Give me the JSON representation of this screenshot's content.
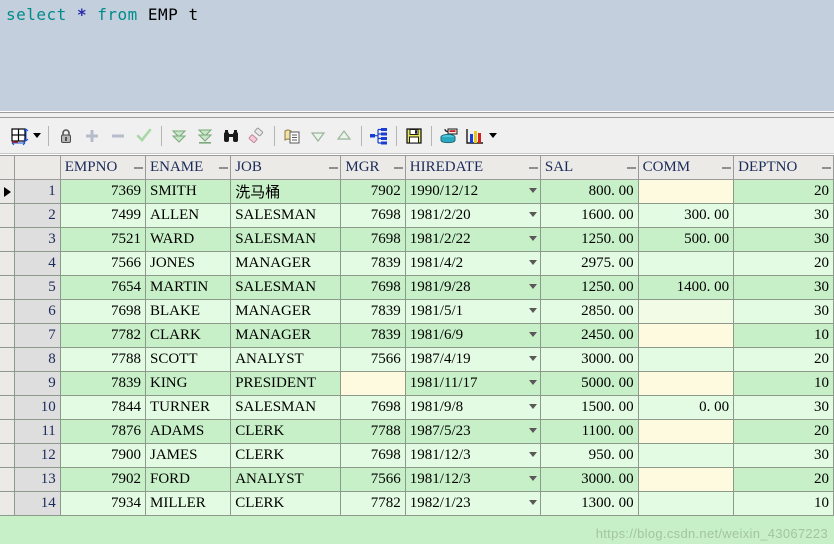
{
  "editor": {
    "sql_keyword_1": "select",
    "sql_star": "*",
    "sql_keyword_2": "from",
    "sql_table": "EMP",
    "sql_alias": "t",
    "full_sql": "select * from EMP t"
  },
  "toolbar": {
    "buttons": [
      {
        "name": "grid-layout-icon",
        "title": "Grid layout",
        "dropdown": true
      },
      {
        "name": "lock-icon",
        "title": "Lock record",
        "dropdown": false
      },
      {
        "name": "plus-icon",
        "title": "Insert record",
        "dropdown": false
      },
      {
        "name": "minus-icon",
        "title": "Delete record",
        "dropdown": false
      },
      {
        "name": "check-icon",
        "title": "Post changes",
        "dropdown": false
      },
      {
        "name": "export-down-icon",
        "title": "Fetch next page",
        "dropdown": false
      },
      {
        "name": "export-last-icon",
        "title": "Fetch last page",
        "dropdown": false
      },
      {
        "name": "binoculars-icon",
        "title": "Find",
        "dropdown": false
      },
      {
        "name": "eraser-icon",
        "title": "Clear filter",
        "dropdown": false
      },
      {
        "name": "copy-icon",
        "title": "Copy to clipboard",
        "dropdown": false
      },
      {
        "name": "sort-desc-icon",
        "title": "Sort descending",
        "dropdown": false
      },
      {
        "name": "sort-asc-icon",
        "title": "Sort ascending",
        "dropdown": false
      },
      {
        "name": "tree-view-icon",
        "title": "Tree view",
        "dropdown": false
      },
      {
        "name": "save-icon",
        "title": "Save",
        "dropdown": false
      },
      {
        "name": "db-export-icon",
        "title": "Export data",
        "dropdown": false
      },
      {
        "name": "bar-chart-icon",
        "title": "Chart",
        "dropdown": true
      }
    ]
  },
  "grid": {
    "columns": [
      "EMPNO",
      "ENAME",
      "JOB",
      "MGR",
      "HIREDATE",
      "SAL",
      "COMM",
      "DEPTNO"
    ],
    "rows": [
      {
        "n": "1",
        "EMPNO": "7369",
        "ENAME": "SMITH",
        "JOB": "洗马桶",
        "MGR": "7902",
        "HIREDATE": "1990/12/12",
        "SAL": "800. 00",
        "COMM": "",
        "DEPTNO": "20"
      },
      {
        "n": "2",
        "EMPNO": "7499",
        "ENAME": "ALLEN",
        "JOB": "SALESMAN",
        "MGR": "7698",
        "HIREDATE": "1981/2/20",
        "SAL": "1600. 00",
        "COMM": "300. 00",
        "DEPTNO": "30"
      },
      {
        "n": "3",
        "EMPNO": "7521",
        "ENAME": "WARD",
        "JOB": "SALESMAN",
        "MGR": "7698",
        "HIREDATE": "1981/2/22",
        "SAL": "1250. 00",
        "COMM": "500. 00",
        "DEPTNO": "30"
      },
      {
        "n": "4",
        "EMPNO": "7566",
        "ENAME": "JONES",
        "JOB": "MANAGER",
        "MGR": "7839",
        "HIREDATE": "1981/4/2",
        "SAL": "2975. 00",
        "COMM": "",
        "DEPTNO": "20"
      },
      {
        "n": "5",
        "EMPNO": "7654",
        "ENAME": "MARTIN",
        "JOB": "SALESMAN",
        "MGR": "7698",
        "HIREDATE": "1981/9/28",
        "SAL": "1250. 00",
        "COMM": "1400. 00",
        "DEPTNO": "30"
      },
      {
        "n": "6",
        "EMPNO": "7698",
        "ENAME": "BLAKE",
        "JOB": "MANAGER",
        "MGR": "7839",
        "HIREDATE": "1981/5/1",
        "SAL": "2850. 00",
        "COMM": "",
        "DEPTNO": "30"
      },
      {
        "n": "7",
        "EMPNO": "7782",
        "ENAME": "CLARK",
        "JOB": "MANAGER",
        "MGR": "7839",
        "HIREDATE": "1981/6/9",
        "SAL": "2450. 00",
        "COMM": "",
        "DEPTNO": "10"
      },
      {
        "n": "8",
        "EMPNO": "7788",
        "ENAME": "SCOTT",
        "JOB": "ANALYST",
        "MGR": "7566",
        "HIREDATE": "1987/4/19",
        "SAL": "3000. 00",
        "COMM": "",
        "DEPTNO": "20"
      },
      {
        "n": "9",
        "EMPNO": "7839",
        "ENAME": "KING",
        "JOB": "PRESIDENT",
        "MGR": "",
        "HIREDATE": "1981/11/17",
        "SAL": "5000. 00",
        "COMM": "",
        "DEPTNO": "10"
      },
      {
        "n": "10",
        "EMPNO": "7844",
        "ENAME": "TURNER",
        "JOB": "SALESMAN",
        "MGR": "7698",
        "HIREDATE": "1981/9/8",
        "SAL": "1500. 00",
        "COMM": "0. 00",
        "DEPTNO": "30"
      },
      {
        "n": "11",
        "EMPNO": "7876",
        "ENAME": "ADAMS",
        "JOB": "CLERK",
        "MGR": "7788",
        "HIREDATE": "1987/5/23",
        "SAL": "1100. 00",
        "COMM": "",
        "DEPTNO": "20"
      },
      {
        "n": "12",
        "EMPNO": "7900",
        "ENAME": "JAMES",
        "JOB": "CLERK",
        "MGR": "7698",
        "HIREDATE": "1981/12/3",
        "SAL": "950. 00",
        "COMM": "",
        "DEPTNO": "30"
      },
      {
        "n": "13",
        "EMPNO": "7902",
        "ENAME": "FORD",
        "JOB": "ANALYST",
        "MGR": "7566",
        "HIREDATE": "1981/12/3",
        "SAL": "3000. 00",
        "COMM": "",
        "DEPTNO": "20"
      },
      {
        "n": "14",
        "EMPNO": "7934",
        "ENAME": "MILLER",
        "JOB": "CLERK",
        "MGR": "7782",
        "HIREDATE": "1982/1/23",
        "SAL": "1300. 00",
        "COMM": "",
        "DEPTNO": "10"
      }
    ],
    "selected_row_index": 0,
    "null_yellow_cells": [
      {
        "row": 1,
        "col": "COMM"
      },
      {
        "row": 6,
        "col": "COMM"
      },
      {
        "row": 7,
        "col": "COMM"
      },
      {
        "row": 9,
        "col": "MGR"
      },
      {
        "row": 9,
        "col": "COMM"
      },
      {
        "row": 11,
        "col": "COMM"
      },
      {
        "row": 13,
        "col": "COMM"
      }
    ]
  },
  "watermark": {
    "text": "https://blog.csdn.net/weixin_43067223"
  },
  "colors": {
    "editor_bg": "#c3cfdc",
    "keyword": "#008b8b",
    "star": "#2a2ab0",
    "row_odd": "#c8f0c8",
    "row_even": "#e2fbe2",
    "null_cell": "#fdfae0",
    "header_bg": "#eceae6",
    "rownum_bg": "#dedede",
    "toolbar_bg": "#f0f0f0"
  }
}
